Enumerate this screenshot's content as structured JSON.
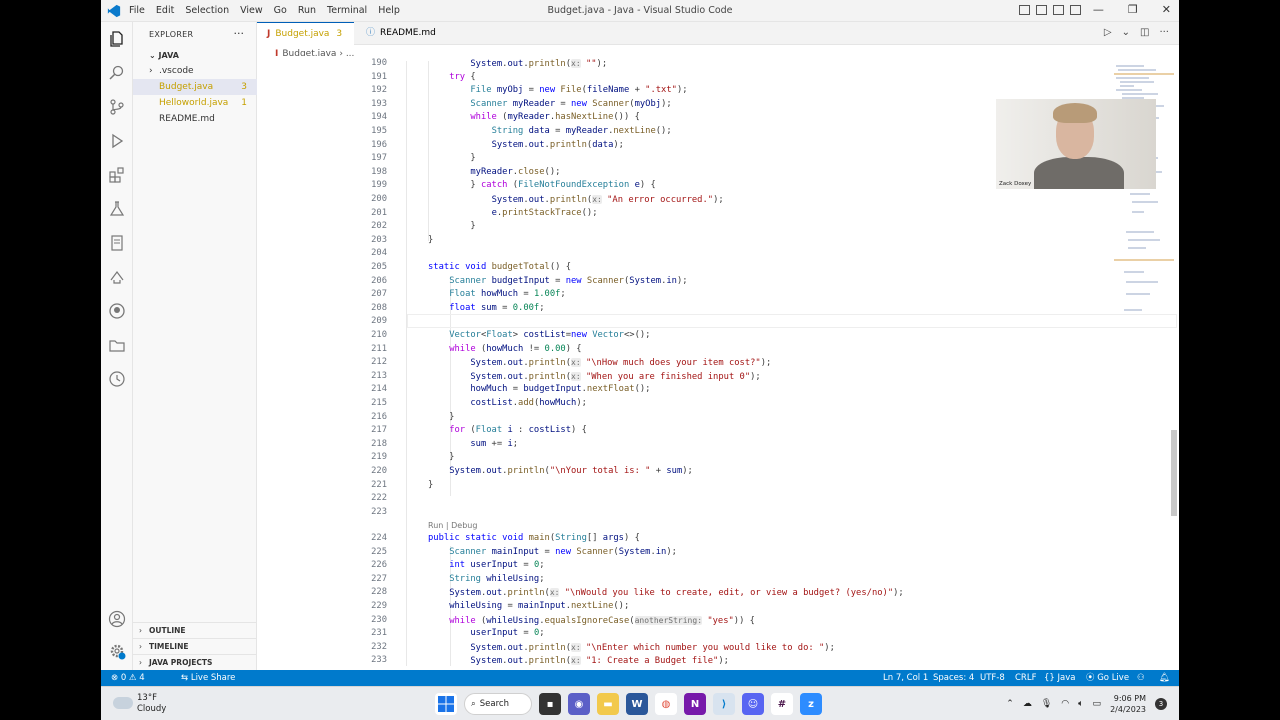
{
  "window": {
    "title": "Budget.java - Java - Visual Studio Code",
    "menu": [
      "File",
      "Edit",
      "Selection",
      "View",
      "Go",
      "Run",
      "Terminal",
      "Help"
    ]
  },
  "explorer": {
    "header": "EXPLORER",
    "more": "···",
    "section": "JAVA",
    "items": [
      {
        "label": ".vscode",
        "chevron": "›"
      },
      {
        "label": "Budget.java",
        "count": "3"
      },
      {
        "label": "Helloworld.java",
        "count": "1"
      },
      {
        "label": "README.md"
      }
    ],
    "bottom_sections": [
      "OUTLINE",
      "TIMELINE",
      "JAVA PROJECTS"
    ]
  },
  "tabs": [
    {
      "label": "Budget.java",
      "badge": "3",
      "close": "✕"
    },
    {
      "label": "README.md"
    }
  ],
  "breadcrumb": {
    "file": "Budget.java",
    "sep": "›",
    "more": "..."
  },
  "code": {
    "codelens": "Run | Debug",
    "partial_line_190": "System.out.println(x: \"\");"
  },
  "webcam": {
    "name": "Zack Doxey"
  },
  "statusbar": {
    "problems": "⊗ 0 ⚠ 4",
    "liveshare": "Live Share",
    "position": "Ln 7, Col 1",
    "spaces": "Spaces: 4",
    "encoding": "UTF-8",
    "eol": "CRLF",
    "language": "{} Java",
    "golive": "Go Live"
  },
  "taskbar": {
    "temperature": "13°F",
    "condition": "Cloudy",
    "search": "Search",
    "time": "9:06 PM",
    "date": "2/4/2023",
    "notifications": "3"
  },
  "colors": {
    "statusbar": "#007acc",
    "accent": "#005fb8",
    "keyword": "#0000ff",
    "control": "#af00db",
    "type": "#267f99",
    "string": "#a31515",
    "number": "#098658"
  }
}
